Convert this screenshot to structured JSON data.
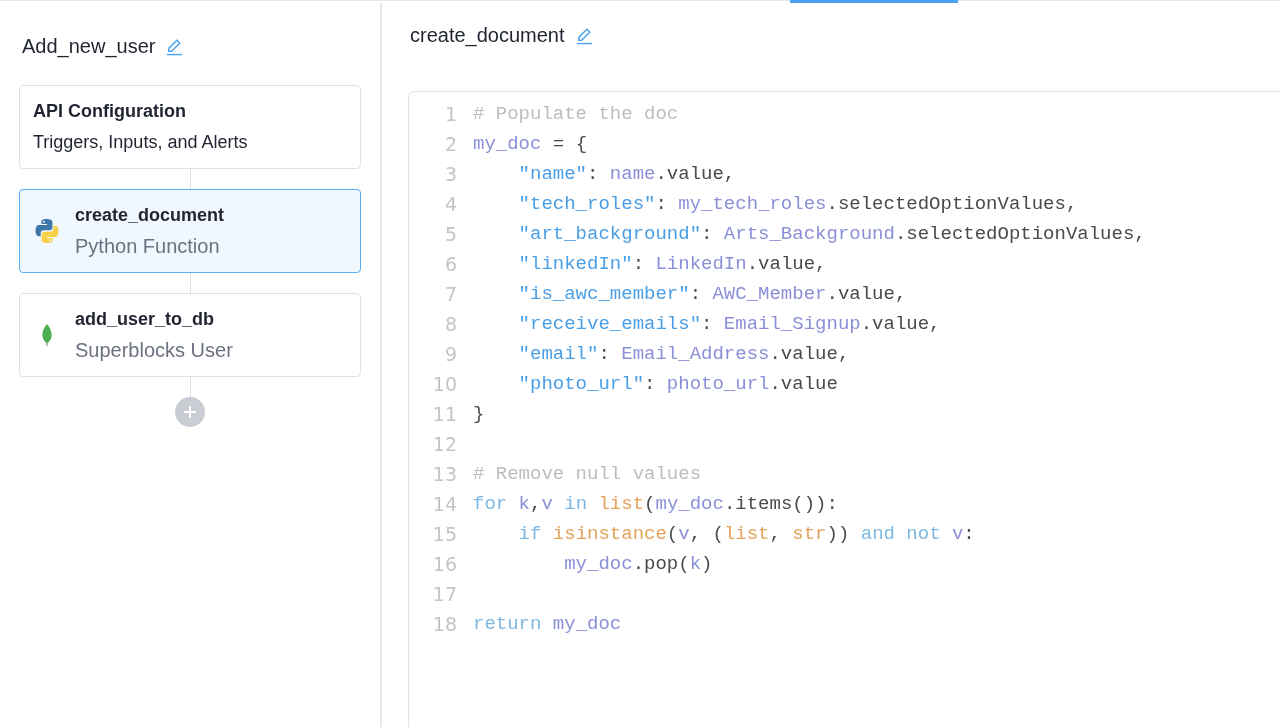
{
  "sidebar": {
    "title": "Add_new_user",
    "steps": [
      {
        "kind": "config",
        "title": "API Configuration",
        "subtitle": "Triggers, Inputs, and Alerts",
        "selected": false
      },
      {
        "kind": "python",
        "title": "create_document",
        "subtitle": "Python Function",
        "selected": true
      },
      {
        "kind": "database",
        "title": "add_user_to_db",
        "subtitle": "Superblocks User",
        "selected": false
      }
    ]
  },
  "editor": {
    "title": "create_document",
    "lines": [
      {
        "number": "1",
        "tokens": [
          {
            "kind": "comment",
            "text": "# Populate the doc"
          }
        ]
      },
      {
        "number": "2",
        "tokens": [
          {
            "kind": "variable",
            "text": "my_doc"
          },
          {
            "kind": "plain",
            "text": " = {"
          }
        ]
      },
      {
        "number": "3",
        "tokens": [
          {
            "kind": "string",
            "text": "    \"name\""
          },
          {
            "kind": "plain",
            "text": ": "
          },
          {
            "kind": "variable",
            "text": "name"
          },
          {
            "kind": "plain",
            "text": ".value,"
          }
        ]
      },
      {
        "number": "4",
        "tokens": [
          {
            "kind": "string",
            "text": "    \"tech_roles\""
          },
          {
            "kind": "plain",
            "text": ": "
          },
          {
            "kind": "variable",
            "text": "my_tech_roles"
          },
          {
            "kind": "plain",
            "text": ".selectedOptionValues,"
          }
        ]
      },
      {
        "number": "5",
        "tokens": [
          {
            "kind": "string",
            "text": "    \"art_background\""
          },
          {
            "kind": "plain",
            "text": ": "
          },
          {
            "kind": "variable",
            "text": "Arts_Background"
          },
          {
            "kind": "plain",
            "text": ".selectedOptionValues,"
          }
        ]
      },
      {
        "number": "6",
        "tokens": [
          {
            "kind": "string",
            "text": "    \"linkedIn\""
          },
          {
            "kind": "plain",
            "text": ": "
          },
          {
            "kind": "variable",
            "text": "LinkedIn"
          },
          {
            "kind": "plain",
            "text": ".value,"
          }
        ]
      },
      {
        "number": "7",
        "tokens": [
          {
            "kind": "string",
            "text": "    \"is_awc_member\""
          },
          {
            "kind": "plain",
            "text": ": "
          },
          {
            "kind": "variable",
            "text": "AWC_Member"
          },
          {
            "kind": "plain",
            "text": ".value,"
          }
        ]
      },
      {
        "number": "8",
        "tokens": [
          {
            "kind": "string",
            "text": "    \"receive_emails\""
          },
          {
            "kind": "plain",
            "text": ": "
          },
          {
            "kind": "variable",
            "text": "Email_Signup"
          },
          {
            "kind": "plain",
            "text": ".value,"
          }
        ]
      },
      {
        "number": "9",
        "tokens": [
          {
            "kind": "string",
            "text": "    \"email\""
          },
          {
            "kind": "plain",
            "text": ": "
          },
          {
            "kind": "variable",
            "text": "Email_Address"
          },
          {
            "kind": "plain",
            "text": ".value,"
          }
        ]
      },
      {
        "number": "10",
        "tokens": [
          {
            "kind": "string",
            "text": "    \"photo_url\""
          },
          {
            "kind": "plain",
            "text": ": "
          },
          {
            "kind": "variable",
            "text": "photo_url"
          },
          {
            "kind": "plain",
            "text": ".value"
          }
        ]
      },
      {
        "number": "11",
        "tokens": [
          {
            "kind": "plain",
            "text": "}"
          }
        ]
      },
      {
        "number": "12"
      },
      {
        "number": "13",
        "tokens": [
          {
            "kind": "comment",
            "text": "# Remove null values"
          }
        ]
      },
      {
        "number": "14",
        "tokens": [
          {
            "kind": "keyword",
            "text": "for"
          },
          {
            "kind": "variable",
            "text": " k"
          },
          {
            "kind": "plain",
            "text": ","
          },
          {
            "kind": "variable",
            "text": "v"
          },
          {
            "kind": "keyword",
            "text": " in"
          },
          {
            "kind": "builtin",
            "text": " list"
          },
          {
            "kind": "plain",
            "text": "("
          },
          {
            "kind": "variable",
            "text": "my_doc"
          },
          {
            "kind": "plain",
            "text": ".items()):"
          }
        ]
      },
      {
        "number": "15",
        "tokens": [
          {
            "kind": "keyword",
            "text": "    if"
          },
          {
            "kind": "builtin",
            "text": " isinstance"
          },
          {
            "kind": "plain",
            "text": "("
          },
          {
            "kind": "variable",
            "text": "v"
          },
          {
            "kind": "plain",
            "text": ", ("
          },
          {
            "kind": "builtin",
            "text": "list"
          },
          {
            "kind": "plain",
            "text": ", "
          },
          {
            "kind": "builtin",
            "text": "str"
          },
          {
            "kind": "plain",
            "text": "))"
          },
          {
            "kind": "keyword",
            "text": " and not"
          },
          {
            "kind": "variable",
            "text": " v"
          },
          {
            "kind": "plain",
            "text": ":"
          }
        ]
      },
      {
        "number": "16",
        "tokens": [
          {
            "kind": "variable",
            "text": "        my_doc"
          },
          {
            "kind": "plain",
            "text": ".pop("
          },
          {
            "kind": "variable",
            "text": "k"
          },
          {
            "kind": "plain",
            "text": ")"
          }
        ]
      },
      {
        "number": "17"
      },
      {
        "number": "18",
        "tokens": [
          {
            "kind": "keyword",
            "text": "return"
          },
          {
            "kind": "variable",
            "text": " my_doc"
          }
        ]
      }
    ]
  }
}
